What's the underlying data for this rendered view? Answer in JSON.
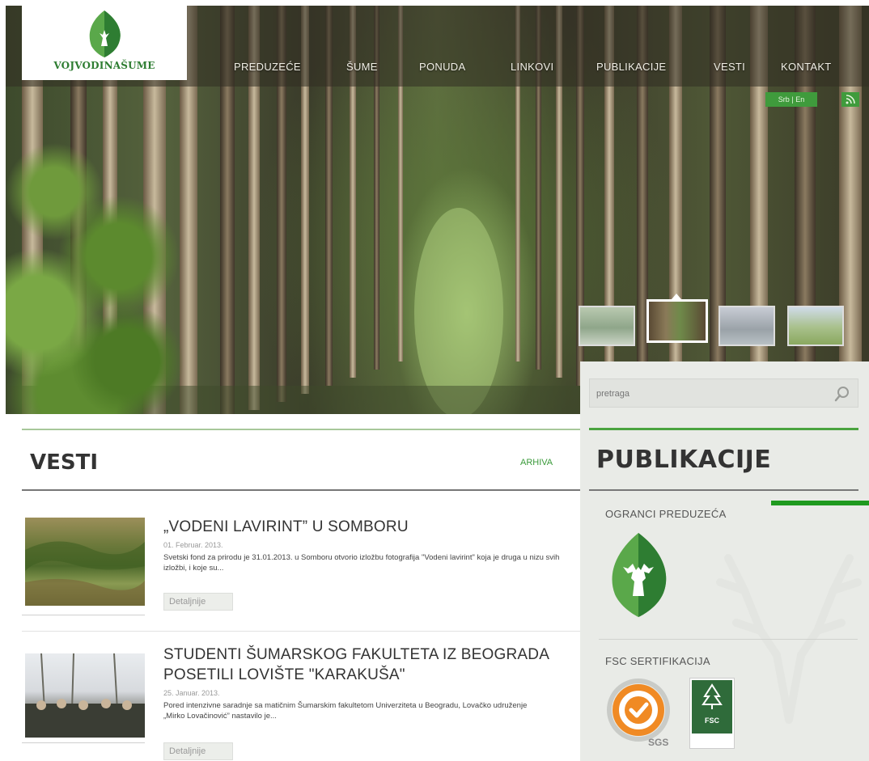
{
  "logo": {
    "text": "VOJVODINAŠUME"
  },
  "nav": {
    "items": [
      {
        "label": "PREDUZEĆE"
      },
      {
        "label": "ŠUME"
      },
      {
        "label": "PONUDA"
      },
      {
        "label": "LINKOVI"
      },
      {
        "label": "PUBLIKACIJE"
      },
      {
        "label": "VESTI"
      },
      {
        "label": "KONTAKT"
      }
    ]
  },
  "lang": {
    "srb": "Srb",
    "sep": "|",
    "en": "En"
  },
  "search": {
    "placeholder": "pretraga"
  },
  "news": {
    "section_title": "VESTI",
    "archive_label": "ARHIVA",
    "items": [
      {
        "title": "„VODENI LAVIRINT” U SOMBORU",
        "date": "01. Februar. 2013.",
        "text": "Svetski fond za prirodu je 31.01.2013. u Somboru otvorio izložbu fotografija \"Vodeni lavirint\" koja je druga u nizu svih izložbi, i koje su...",
        "details": "Detaljnije"
      },
      {
        "title_line1": "STUDENTI ŠUMARSKOG FAKULTETA IZ BEOGRADA",
        "title_line2": "POSETILI LOVIŠTE \"KARAKUŠA\"",
        "date": "25. Januar. 2013.",
        "text": "Pored intenzivne saradnje sa matičnim Šumarskim fakultetom Univerziteta u Beogradu, Lovačko udruženje „Mirko Lovačinović” nastavilo je...",
        "details": "Detaljnije"
      }
    ]
  },
  "sidebar": {
    "title": "PUBLIKACIJE",
    "ogranci_label": "OGRANCI PREDUZEĆA",
    "fsc_label": "FSC SERTIFIKACIJA",
    "sgs_label": "SGS",
    "fsc_badge": "FSC"
  },
  "colors": {
    "brand_green": "#3f9b3c",
    "accent_line": "#1f9a1f",
    "text_dark": "#333333"
  }
}
